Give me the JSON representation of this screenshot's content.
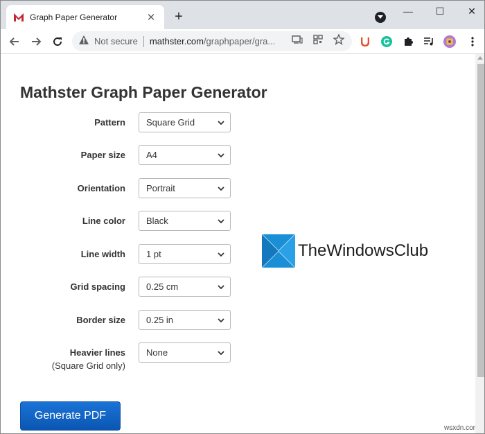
{
  "browser": {
    "tab_title": "Graph Paper Generator",
    "tab_close": "✕",
    "new_tab": "+",
    "minimize": "—",
    "maximize": "☐",
    "close": "✕",
    "url_security": "Not secure",
    "url_host": "mathster.com",
    "url_path": "/graphpaper/gra...",
    "favicon_color": "#c4262e"
  },
  "page": {
    "title": "Mathster Graph Paper Generator",
    "fields": [
      {
        "label": "Pattern",
        "value": "Square Grid"
      },
      {
        "label": "Paper size",
        "value": "A4"
      },
      {
        "label": "Orientation",
        "value": "Portrait"
      },
      {
        "label": "Line color",
        "value": "Black"
      },
      {
        "label": "Line width",
        "value": "1 pt"
      },
      {
        "label": "Grid spacing",
        "value": "0.25 cm"
      },
      {
        "label": "Border size",
        "value": "0.25 in"
      },
      {
        "label": "Heavier lines",
        "sublabel": "(Square Grid only)",
        "value": "None"
      }
    ],
    "generate_label": "Generate PDF",
    "button_color": "#0f63c5"
  },
  "watermark": {
    "text": "TheWindowsClub",
    "site": "wsxdn.com",
    "logo_color": "#1a8fd6"
  }
}
